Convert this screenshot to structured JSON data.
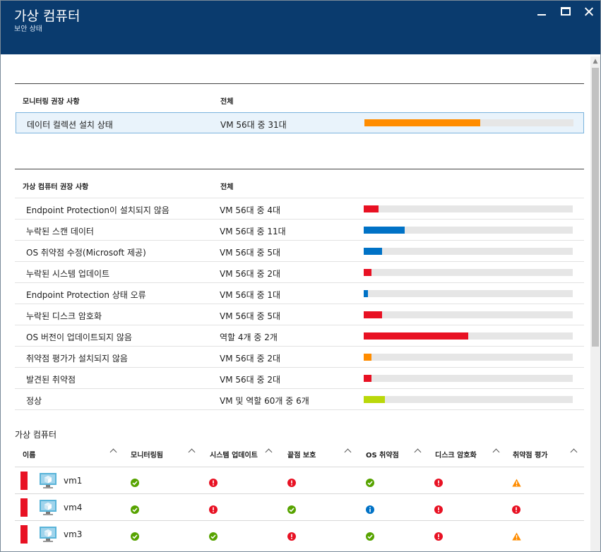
{
  "window": {
    "title": "가상 컴퓨터",
    "subtitle": "보안 상태"
  },
  "monitoring": {
    "header_name": "모니터링 권장 사항",
    "header_total": "전체",
    "rows": [
      {
        "name": "데이터 컬렉션 설치 상태",
        "total": "VM 56대 중 31대",
        "fraction": 0.554,
        "color": "#ff8c00"
      }
    ]
  },
  "vm_recommendations": {
    "header_name": "가상 컴퓨터 권장 사항",
    "header_total": "전체",
    "rows": [
      {
        "name": "Endpoint Protection이 설치되지 않음",
        "total": "VM 56대 중 4대",
        "fraction": 0.071,
        "color": "#e81123"
      },
      {
        "name": "누락된 스캔 데이터",
        "total": "VM 56대 중 11대",
        "fraction": 0.196,
        "color": "#0072c6"
      },
      {
        "name": "OS 취약점 수정(Microsoft 제공)",
        "total": "VM 56대 중 5대",
        "fraction": 0.089,
        "color": "#0072c6"
      },
      {
        "name": "누락된 시스템 업데이트",
        "total": "VM 56대 중 2대",
        "fraction": 0.036,
        "color": "#e81123"
      },
      {
        "name": "Endpoint Protection 상태 오류",
        "total": "VM 56대 중 1대",
        "fraction": 0.018,
        "color": "#0072c6"
      },
      {
        "name": "누락된 디스크 암호화",
        "total": "VM 56대 중 5대",
        "fraction": 0.089,
        "color": "#e81123"
      },
      {
        "name": "OS 버전이 업데이트되지 않음",
        "total": "역할 4개 중 2개",
        "fraction": 0.5,
        "color": "#e81123"
      },
      {
        "name": "취약점 평가가 설치되지 않음",
        "total": "VM 56대 중 2대",
        "fraction": 0.036,
        "color": "#ff8c00"
      },
      {
        "name": "발견된 취약점",
        "total": "VM 56대 중 2대",
        "fraction": 0.036,
        "color": "#e81123"
      },
      {
        "name": "정상",
        "total": "VM 및 역할 60개 중 6개",
        "fraction": 0.1,
        "color": "#bad80a"
      }
    ]
  },
  "vm_list": {
    "title": "가상 컴퓨터",
    "columns": [
      "이름",
      "모니터링됨",
      "시스템 업데이트",
      "끝점 보호",
      "OS 취약점",
      "디스크 암호화",
      "취약점 평가"
    ],
    "rows": [
      {
        "name": "vm1",
        "status": [
          "ok",
          "error",
          "error",
          "ok",
          "error",
          "warning"
        ]
      },
      {
        "name": "vm4",
        "status": [
          "ok",
          "error",
          "ok",
          "info",
          "error",
          "error"
        ]
      },
      {
        "name": "vm3",
        "status": [
          "ok",
          "ok",
          "error",
          "ok",
          "error",
          "warning"
        ]
      }
    ]
  },
  "icons": {
    "ok": "check-circle-icon",
    "error": "error-circle-icon",
    "warning": "warning-triangle-icon",
    "info": "info-circle-icon"
  },
  "colors": {
    "titlebar": "#0a3b6e",
    "critical": "#e81123",
    "warning": "#ff8c00",
    "info": "#0072c6",
    "healthy": "#bad80a",
    "ok_icon": "#57a300"
  }
}
